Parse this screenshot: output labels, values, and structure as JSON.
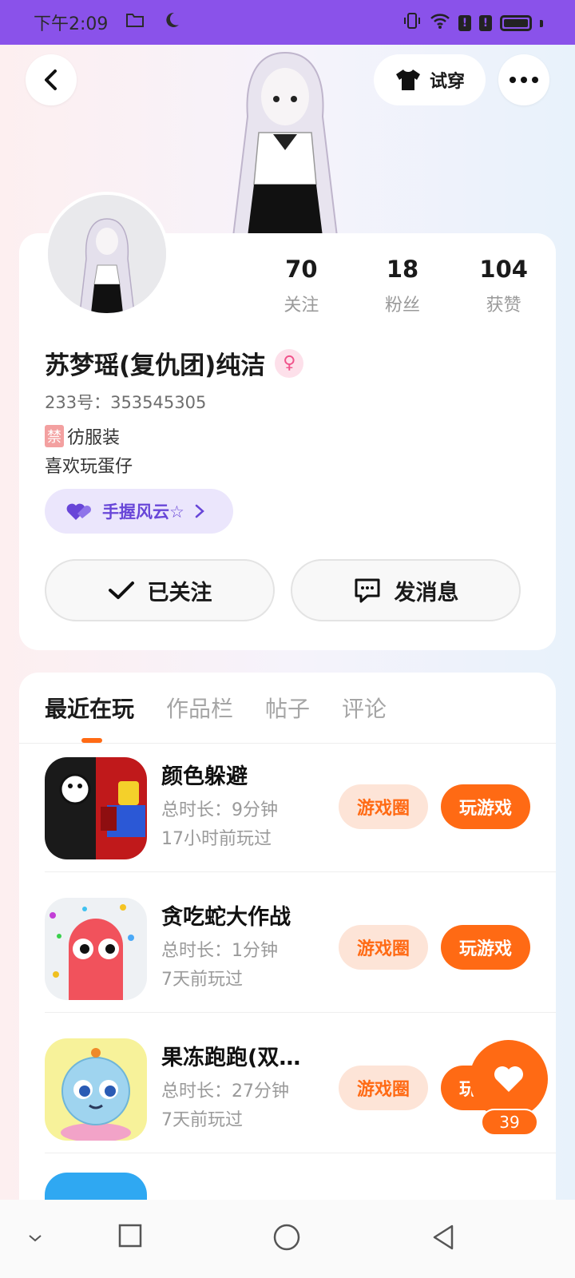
{
  "status_bar": {
    "time": "下午2:09",
    "alert1": "!",
    "alert2": "!"
  },
  "top": {
    "tryon_label": "试穿"
  },
  "profile": {
    "stats": [
      {
        "num": "70",
        "label": "关注"
      },
      {
        "num": "18",
        "label": "粉丝"
      },
      {
        "num": "104",
        "label": "获赞"
      }
    ],
    "name": "苏梦瑶(复仇团)纯洁",
    "uid": "233号：353545305",
    "bio_tag": "禁",
    "bio_line1": "彷服装",
    "bio_line2": "喜欢玩蛋仔",
    "clan": "手握风云☆",
    "follow_label": "已关注",
    "message_label": "发消息"
  },
  "tabs": [
    {
      "label": "最近在玩",
      "active": true
    },
    {
      "label": "作品栏",
      "active": false
    },
    {
      "label": "帖子",
      "active": false
    },
    {
      "label": "评论",
      "active": false
    }
  ],
  "games": [
    {
      "title": "颜色躲避",
      "duration": "总时长：9分钟",
      "last_played": "17小时前玩过",
      "circle_label": "游戏圈",
      "play_label": "玩游戏"
    },
    {
      "title": "贪吃蛇大作战",
      "duration": "总时长：1分钟",
      "last_played": "7天前玩过",
      "circle_label": "游戏圈",
      "play_label": "玩游戏"
    },
    {
      "title": "果冻跑跑(双旦…",
      "duration": "总时长：27分钟",
      "last_played": "7天前玩过",
      "circle_label": "游戏圈",
      "play_label": "玩游戏"
    }
  ],
  "like": {
    "count": "39"
  },
  "colors": {
    "accent": "#ff6a14",
    "status_bar": "#8a52ea",
    "clan": "#6846d8"
  }
}
